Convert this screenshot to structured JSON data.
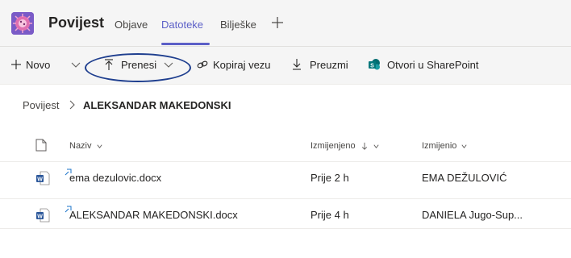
{
  "header": {
    "team_name": "Povijest",
    "tabs": [
      {
        "label": "Objave",
        "active": false
      },
      {
        "label": "Datoteke",
        "active": true
      },
      {
        "label": "Bilješke",
        "active": false
      }
    ],
    "add_tab_icon": "plus-icon",
    "accent_color": "#5b5fc7"
  },
  "toolbar": {
    "new_label": "Novo",
    "upload_label": "Prenesi",
    "copy_link_label": "Kopiraj vezu",
    "download_label": "Preuzmi",
    "sharepoint_label": "Otvori u SharePoint",
    "highlight_color": "#1f3f8f"
  },
  "breadcrumb": {
    "root": "Povijest",
    "current": "ALEKSANDAR MAKEDONSKI"
  },
  "list": {
    "columns": {
      "name": "Naziv",
      "modified": "Izmijenjeno",
      "modified_by": "Izmijenio"
    },
    "rows": [
      {
        "name": "ema dezulovic.docx",
        "modified": "Prije 2 h",
        "modified_by": "EMA DEŽULOVIĆ"
      },
      {
        "name": "ALEKSANDAR MAKEDONSKI.docx",
        "modified": "Prije 4 h",
        "modified_by": "DANIELA Jugo-Sup..."
      }
    ]
  }
}
